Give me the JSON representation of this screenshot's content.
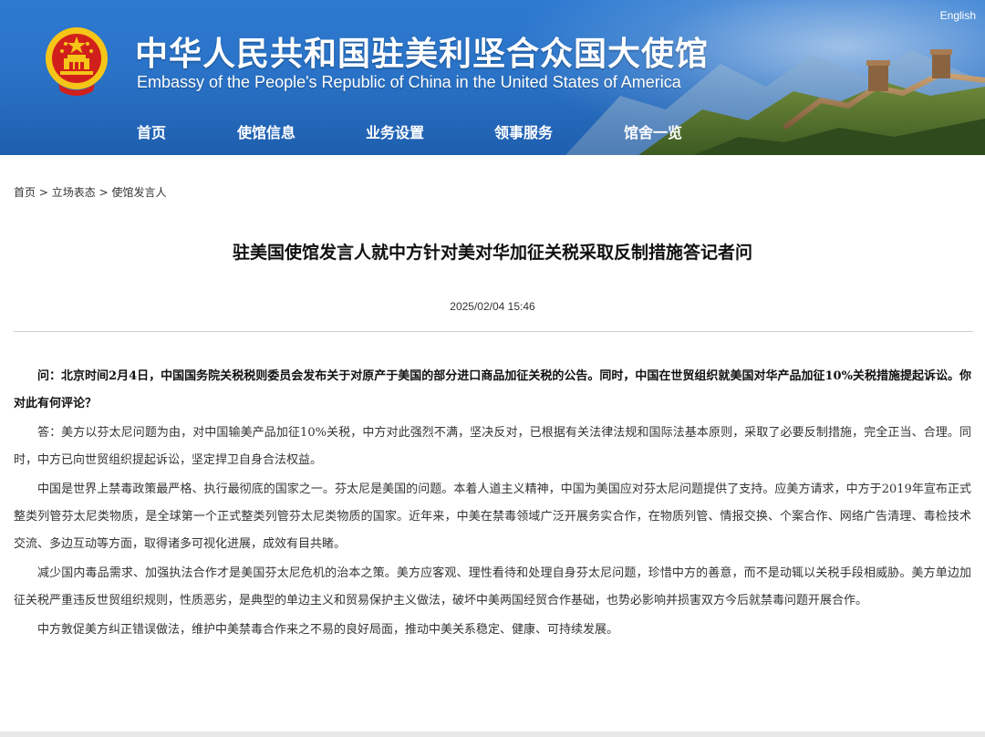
{
  "header": {
    "title_cn": "中华人民共和国驻美利坚合众国大使馆",
    "title_en": "Embassy of the People's Republic of China in the United States of America",
    "language_link": "English",
    "nav": [
      {
        "label": "首页"
      },
      {
        "label": "使馆信息"
      },
      {
        "label": "业务设置"
      },
      {
        "label": "领事服务"
      },
      {
        "label": "馆舍一览"
      }
    ],
    "colors": {
      "banner": "#2a73c8",
      "emblem_red": "#d1201c",
      "emblem_gold": "#f5c518"
    }
  },
  "breadcrumb": {
    "items": [
      "首页",
      "立场表态",
      "使馆发言人"
    ],
    "separator": ">"
  },
  "article": {
    "title": "驻美国使馆发言人就中方针对美对华加征关税采取反制措施答记者问",
    "date": "2025/02/04 15:46",
    "question": "问：北京时间2月4日，中国国务院关税税则委员会发布关于对原产于美国的部分进口商品加征关税的公告。同时，中国在世贸组织就美国对华产品加征10%关税措施提起诉讼。你对此有何评论？",
    "paragraphs": [
      "答：美方以芬太尼问题为由，对中国输美产品加征10%关税，中方对此强烈不满，坚决反对，已根据有关法律法规和国际法基本原则，采取了必要反制措施，完全正当、合理。同时，中方已向世贸组织提起诉讼，坚定捍卫自身合法权益。",
      "中国是世界上禁毒政策最严格、执行最彻底的国家之一。芬太尼是美国的问题。本着人道主义精神，中国为美国应对芬太尼问题提供了支持。应美方请求，中方于2019年宣布正式整类列管芬太尼类物质，是全球第一个正式整类列管芬太尼类物质的国家。近年来，中美在禁毒领域广泛开展务实合作，在物质列管、情报交换、个案合作、网络广告清理、毒检技术交流、多边互动等方面，取得诸多可视化进展，成效有目共睹。",
      "减少国内毒品需求、加强执法合作才是美国芬太尼危机的治本之策。美方应客观、理性看待和处理自身芬太尼问题，珍惜中方的善意，而不是动辄以关税手段相威胁。美方单边加征关税严重违反世贸组织规则，性质恶劣，是典型的单边主义和贸易保护主义做法，破坏中美两国经贸合作基础，也势必影响并损害双方今后就禁毒问题开展合作。",
      "中方敦促美方纠正错误做法，维护中美禁毒合作来之不易的良好局面，推动中美关系稳定、健康、可持续发展。"
    ]
  }
}
